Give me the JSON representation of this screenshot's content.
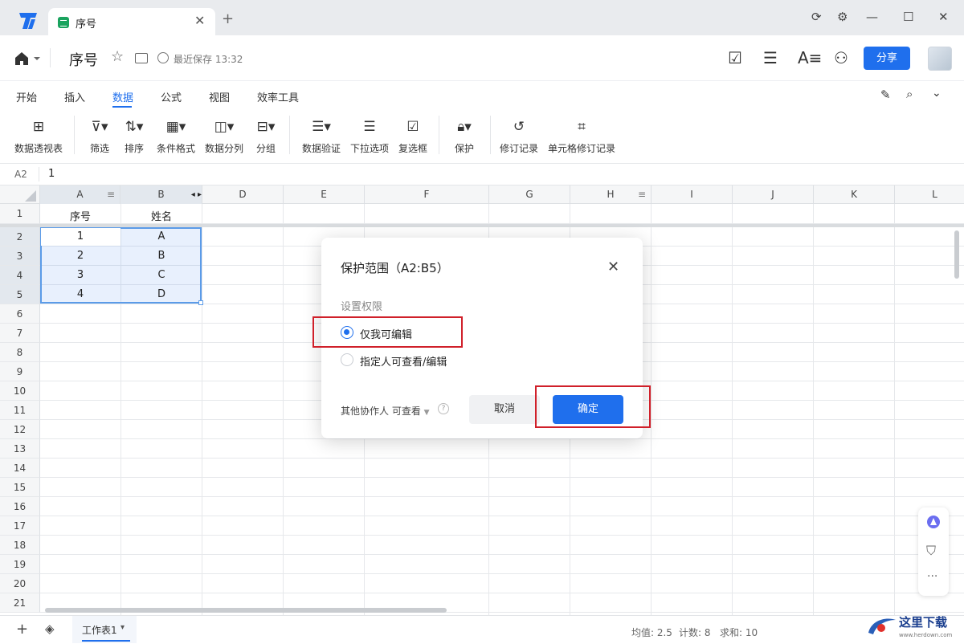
{
  "titlebar": {
    "tab_title": "序号"
  },
  "docbar": {
    "title": "序号",
    "save_status": "最近保存 13:32",
    "share_label": "分享"
  },
  "menu": {
    "tabs": [
      "开始",
      "插入",
      "数据",
      "公式",
      "视图",
      "效率工具"
    ],
    "active": "数据"
  },
  "toolbar": {
    "items": [
      "数据透视表",
      "筛选",
      "排序",
      "条件格式",
      "数据分列",
      "分组",
      "数据验证",
      "下拉选项",
      "复选框",
      "保护",
      "修订记录",
      "单元格修订记录"
    ]
  },
  "formula": {
    "cell_ref": "A2",
    "value": "1"
  },
  "grid": {
    "columns": [
      "A",
      "B",
      "D",
      "E",
      "F",
      "G",
      "H",
      "I",
      "J",
      "K",
      "L"
    ],
    "rows": [
      "1",
      "2",
      "3",
      "4",
      "5",
      "6",
      "7",
      "8",
      "9",
      "10",
      "11",
      "12",
      "13",
      "14",
      "15",
      "16",
      "17",
      "18",
      "19",
      "20",
      "21"
    ],
    "header_row": [
      "序号",
      "姓名"
    ],
    "data": [
      [
        "1",
        "A"
      ],
      [
        "2",
        "B"
      ],
      [
        "3",
        "C"
      ],
      [
        "4",
        "D"
      ]
    ]
  },
  "dialog": {
    "title": "保护范围（A2:B5）",
    "perm_label": "设置权限",
    "option_only_me": "仅我可编辑",
    "option_specific": "指定人可查看/编辑",
    "collaborators_label": "其他协作人 可查看",
    "help": "?",
    "cancel": "取消",
    "confirm": "确定",
    "selected_option": "仅我可编辑"
  },
  "bottom": {
    "sheet_tab": "工作表1",
    "avg": "均值: 2.5",
    "count": "计数: 8",
    "sum": "求和: 10"
  },
  "watermark": {
    "text": "这里下载",
    "url": "www.herdown.com"
  }
}
